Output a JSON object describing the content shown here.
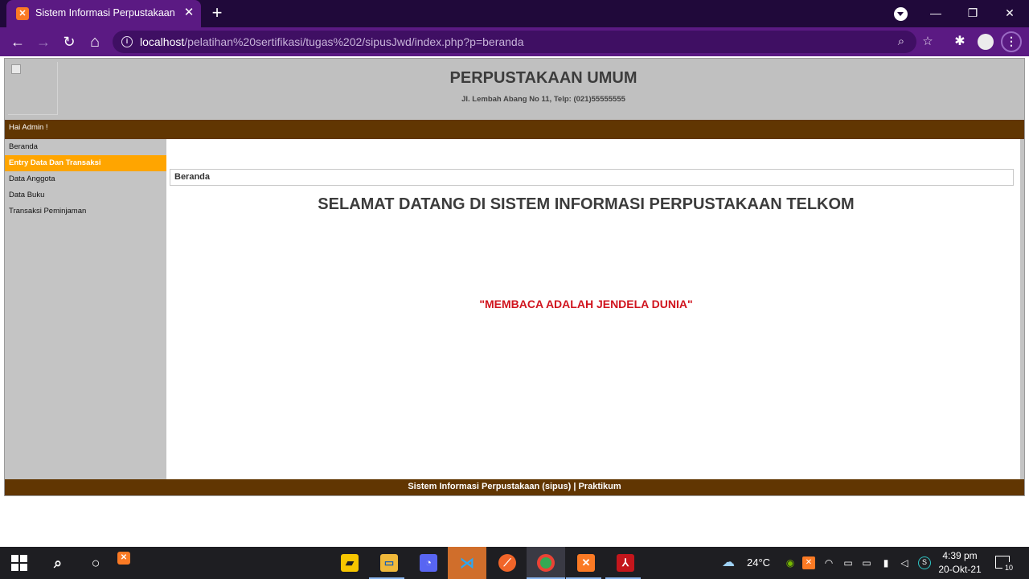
{
  "browser": {
    "tab_title": "Sistem Informasi Perpustakaan",
    "tab_close": "✕",
    "new_tab": "+",
    "url_host": "localhost",
    "url_path": "/pelatihan%20sertifikasi/tugas%202/sipusJwd/index.php?p=beranda",
    "back": "←",
    "forward": "→",
    "reload": "↻",
    "home": "⌂",
    "zoom_icon": "⌕",
    "star_icon": "☆",
    "extensions_icon": "✱",
    "menu_icon": "⋮",
    "minimize": "—",
    "restore": "❐",
    "close": "✕"
  },
  "header": {
    "title": "PERPUSTAKAAN UMUM",
    "address": "Jl. Lembah Abang No 11, Telp: (021)55555555"
  },
  "greeting": "Hai Admin !",
  "sidebar": {
    "items": [
      {
        "label": "Beranda",
        "active": false
      },
      {
        "label": "Entry Data Dan Transaksi",
        "active": true
      },
      {
        "label": "Data Anggota",
        "active": false
      },
      {
        "label": "Data Buku",
        "active": false
      },
      {
        "label": "Transaksi Peminjaman",
        "active": false
      }
    ]
  },
  "main": {
    "breadcrumb": "Beranda",
    "welcome": "SELAMAT DATANG DI SISTEM INFORMASI PERPUSTAKAAN TELKOM",
    "quote": "\"MEMBACA ADALAH JENDELA DUNIA\""
  },
  "footer": "Sistem Informasi Perpustakaan (sipus) | Praktikum",
  "taskbar": {
    "temperature": "24°C",
    "time": "4:39 pm",
    "date": "20-Okt-21",
    "notification_count": "10"
  },
  "colors": {
    "chrome_tab_strip": "#20093a",
    "chrome_toolbar": "#5b1a83",
    "header_bg": "#c0c0c0",
    "bar_brown": "#613602",
    "active_menu": "#ffa500",
    "quote_red": "#d0141e"
  }
}
